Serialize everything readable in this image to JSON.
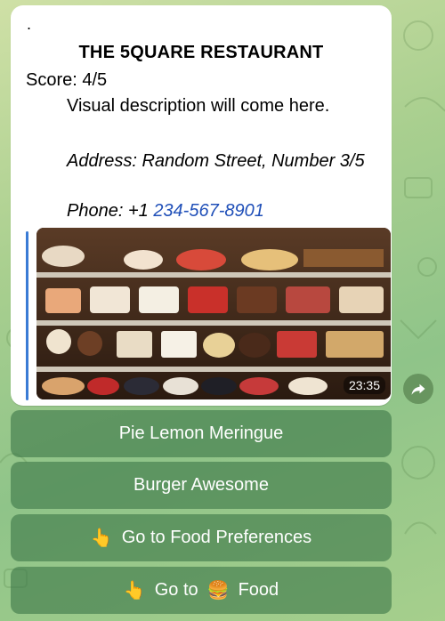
{
  "message": {
    "dot": ".",
    "title": "THE 5QUARE RESTAURANT",
    "score": "Score: 4/5",
    "visual_description": "Visual description will come here.",
    "address": "Address: Random Street, Number 3/5",
    "phone_prefix": "Phone: +1",
    "phone_number": "234-567-8901",
    "media": {
      "duration": "23:35",
      "icon": "video-thumbnail-pastry-display"
    }
  },
  "share_icon": "share-forward-icon",
  "keyboard": {
    "buttons": [
      {
        "emoji": "",
        "label": "Pie Lemon Meringue"
      },
      {
        "emoji": "",
        "label": "Burger Awesome"
      },
      {
        "emoji": "👆",
        "label": "Go to Food Preferences"
      },
      {
        "emoji": "👆",
        "label_before": "Go to",
        "emoji_mid": "🍔",
        "label_after": "Food"
      }
    ]
  },
  "colors": {
    "link": "#1f4fb8",
    "quote_bar": "#3a7bd5",
    "button_bg": "#3e7848"
  }
}
